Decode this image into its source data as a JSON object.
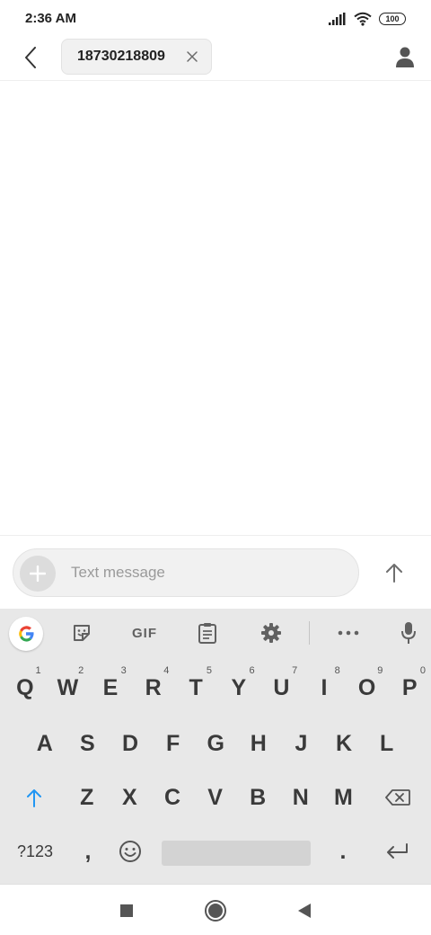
{
  "status_bar": {
    "time": "2:36 AM",
    "battery": "100"
  },
  "header": {
    "recipient": "18730218809"
  },
  "compose": {
    "placeholder": "Text message"
  },
  "keyboard": {
    "toolbar": {
      "gif": "GIF"
    },
    "row1": [
      {
        "label": "Q",
        "hint": "1"
      },
      {
        "label": "W",
        "hint": "2"
      },
      {
        "label": "E",
        "hint": "3"
      },
      {
        "label": "R",
        "hint": "4"
      },
      {
        "label": "T",
        "hint": "5"
      },
      {
        "label": "Y",
        "hint": "6"
      },
      {
        "label": "U",
        "hint": "7"
      },
      {
        "label": "I",
        "hint": "8"
      },
      {
        "label": "O",
        "hint": "9"
      },
      {
        "label": "P",
        "hint": "0"
      }
    ],
    "row2": [
      "A",
      "S",
      "D",
      "F",
      "G",
      "H",
      "J",
      "K",
      "L"
    ],
    "row3": [
      "Z",
      "X",
      "C",
      "V",
      "B",
      "N",
      "M"
    ],
    "row4": {
      "symbols": "?123",
      "comma": ",",
      "period": "."
    }
  },
  "colors": {
    "accent": "#2196f3",
    "keyboard_bg": "#e8e8e8",
    "icon_gray": "#616161"
  }
}
